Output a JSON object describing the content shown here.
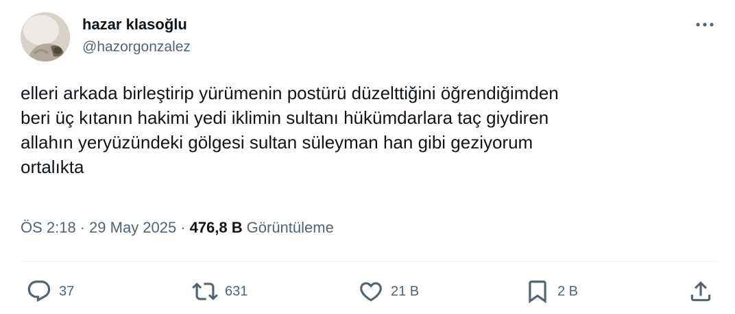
{
  "author": {
    "display_name": "hazar klasoğlu",
    "handle": "@hazorgonzalez"
  },
  "tweet": {
    "lines": [
      "elleri arkada birleştirip yürümenin postürü düzelttiğini öğrendiğimden",
      "beri üç kıtanın hakimi yedi iklimin sultanı hükümdarlara taç giydiren",
      "allahın yeryüzündeki gölgesi sultan süleyman han gibi geziyorum",
      "ortalıkta"
    ]
  },
  "meta": {
    "time": "ÖS 2:18",
    "separator": "·",
    "date": "29 May 2025",
    "views_count": "476,8 B",
    "views_label": "Görüntüleme"
  },
  "actions": {
    "replies": "37",
    "reposts": "631",
    "likes": "21 B",
    "bookmarks": "2 B"
  },
  "icons": {
    "more": "more-horizontal-icon",
    "reply": "reply-icon",
    "repost": "repost-icon",
    "like": "heart-icon",
    "bookmark": "bookmark-icon",
    "share": "share-icon"
  },
  "colors": {
    "text_primary": "#0f1419",
    "text_secondary": "#536471",
    "divider": "#eff3f4"
  }
}
